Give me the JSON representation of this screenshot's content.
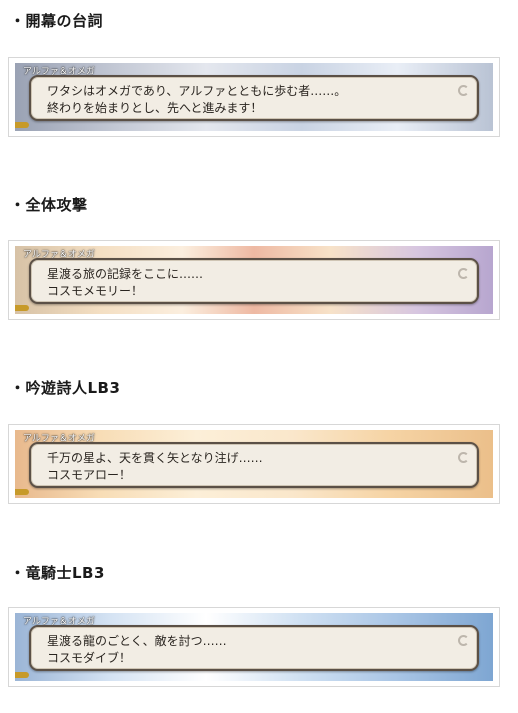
{
  "sections": [
    {
      "heading": "・開幕の台詞",
      "speaker": "アルファ＆オメガ",
      "line1": "ワタシはオメガであり、アルファとともに歩む者……。",
      "line2": "終わりを始まりとし、先へと進みます！"
    },
    {
      "heading": "・全体攻撃",
      "speaker": "アルファ＆オメガ",
      "line1": "星渡る旅の記録をここに……",
      "line2": "コスモメモリー！"
    },
    {
      "heading": "・吟遊詩人LB3",
      "speaker": "アルファ＆オメガ",
      "line1": "千万の星よ、天を貫く矢となり注げ……",
      "line2": "コスモアロー！"
    },
    {
      "heading": "・竜騎士LB3",
      "speaker": "アルファ＆オメガ",
      "line1": "星渡る龍のごとく、敵を討つ……",
      "line2": "コスモダイブ！"
    }
  ]
}
